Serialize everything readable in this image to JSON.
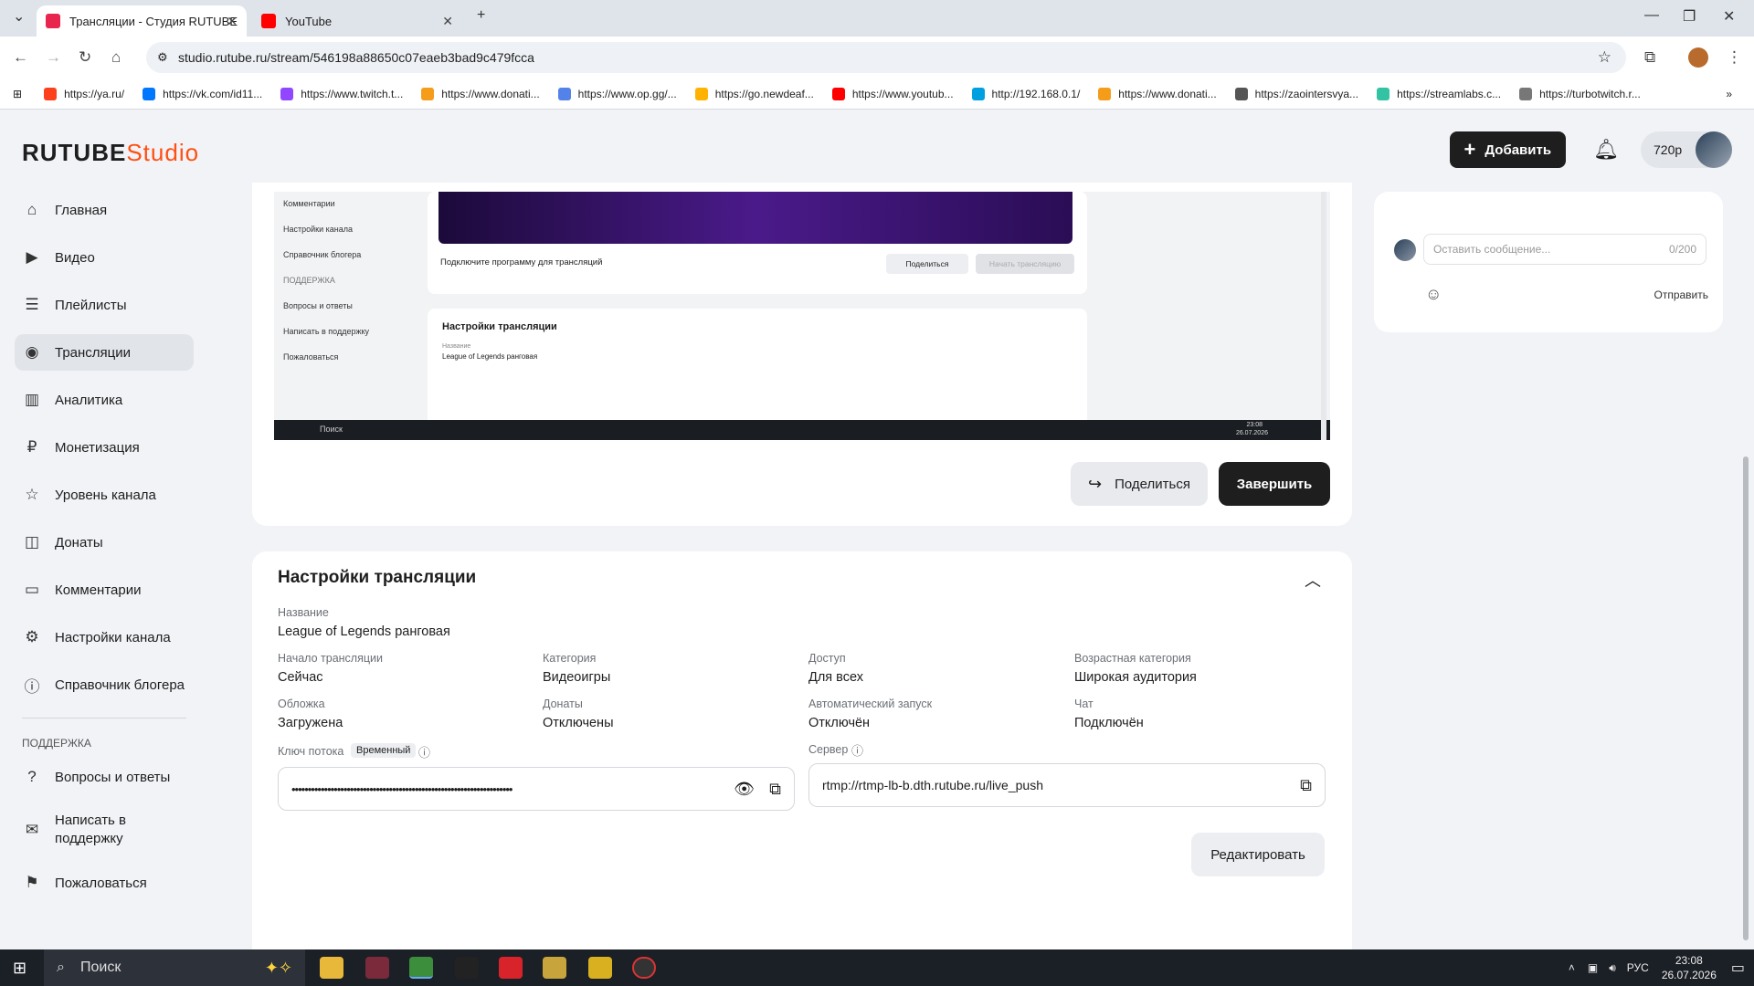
{
  "browser": {
    "tabs": [
      {
        "label": "Трансляции - Студия RUTUBE",
        "active": true,
        "favicon_color": "#e8254f"
      },
      {
        "label": "YouTube",
        "active": false,
        "favicon_color": "#ff0000"
      }
    ],
    "url": "studio.rutube.ru/stream/546198a88650c07eaeb3bad9c479fcca",
    "bookmarks": [
      {
        "label": "https://ya.ru/",
        "color": "#fc3f1d"
      },
      {
        "label": "https://vk.com/id11...",
        "color": "#0077ff"
      },
      {
        "label": "https://www.twitch.t...",
        "color": "#9146ff"
      },
      {
        "label": "https://www.donati...",
        "color": "#f59c1a"
      },
      {
        "label": "https://www.op.gg/...",
        "color": "#5383e8"
      },
      {
        "label": "https://go.newdeaf...",
        "color": "#ffb300"
      },
      {
        "label": "https://www.youtub...",
        "color": "#ff0000"
      },
      {
        "label": "http://192.168.0.1/",
        "color": "#00a0e0"
      },
      {
        "label": "https://www.donati...",
        "color": "#f59c1a"
      },
      {
        "label": "https://zaointersvya...",
        "color": "#555555"
      },
      {
        "label": "https://streamlabs.c...",
        "color": "#31c3a2"
      },
      {
        "label": "https://turbotwitch.r...",
        "color": "#777777"
      }
    ]
  },
  "header": {
    "logo_main": "RUTUBE",
    "logo_studio": "Studio",
    "add_label": "Добавить",
    "quality": "720p"
  },
  "sidebar": {
    "items": [
      {
        "label": "Главная",
        "icon": "home-icon",
        "glyph": "⌂",
        "active": false
      },
      {
        "label": "Видео",
        "icon": "video-icon",
        "glyph": "▶",
        "active": false
      },
      {
        "label": "Плейлисты",
        "icon": "playlist-icon",
        "glyph": "☰",
        "active": false
      },
      {
        "label": "Трансляции",
        "icon": "broadcast-icon",
        "glyph": "◉",
        "active": true
      },
      {
        "label": "Аналитика",
        "icon": "analytics-icon",
        "glyph": "▥",
        "active": false
      },
      {
        "label": "Монетизация",
        "icon": "money-icon",
        "glyph": "₽",
        "active": false
      },
      {
        "label": "Уровень канала",
        "icon": "star-icon",
        "glyph": "☆",
        "active": false
      },
      {
        "label": "Донаты",
        "icon": "donate-icon",
        "glyph": "◫",
        "active": false
      },
      {
        "label": "Комментарии",
        "icon": "comment-icon",
        "glyph": "▭",
        "active": false
      },
      {
        "label": "Настройки канала",
        "icon": "gear-icon",
        "glyph": "⚙",
        "active": false
      },
      {
        "label": "Справочник блогера",
        "icon": "info-icon",
        "glyph": "ⓘ",
        "active": false
      }
    ],
    "support_title": "ПОДДЕРЖКА",
    "support_items": [
      {
        "label": "Вопросы и ответы",
        "icon": "help-icon",
        "glyph": "?"
      },
      {
        "label": "Написать в поддержку",
        "icon": "mail-icon",
        "glyph": "✉"
      },
      {
        "label": "Пожаловаться",
        "icon": "flag-icon",
        "glyph": "⚑"
      }
    ]
  },
  "preview": {
    "sidebar_items": [
      "Комментарии",
      "Настройки канала",
      "Справочник блогера",
      "ПОДДЕРЖКА",
      "Вопросы и ответы",
      "Написать в поддержку",
      "Пожаловаться"
    ],
    "connect_hint": "Подключите программу для трансляций",
    "share": "Поделиться",
    "start": "Начать трансляцию",
    "settings_title": "Настройки трансляции",
    "name_label": "Название",
    "name_value": "League of Legends ранговая",
    "search": "Поиск",
    "time": "23:08",
    "date": "26.07.2026"
  },
  "actions": {
    "share_label": "Поделиться",
    "finish_label": "Завершить"
  },
  "settings": {
    "title": "Настройки трансляции",
    "name_label": "Название",
    "name_value": "League of Legends ранговая",
    "fields": [
      {
        "label": "Начало трансляции",
        "value": "Сейчас"
      },
      {
        "label": "Категория",
        "value": "Видеоигры"
      },
      {
        "label": "Доступ",
        "value": "Для всех"
      },
      {
        "label": "Возрастная категория",
        "value": "Широкая аудитория"
      },
      {
        "label": "Обложка",
        "value": "Загружена"
      },
      {
        "label": "Донаты",
        "value": "Отключены"
      },
      {
        "label": "Автоматический запуск",
        "value": "Отключён"
      },
      {
        "label": "Чат",
        "value": "Подключён"
      }
    ],
    "key_label": "Ключ потока",
    "key_badge": "Временный",
    "key_value": "••••••••••••••••••••••••••••••••••••••••••••••••••••••••••••••••••••",
    "server_label": "Сервер",
    "server_value": "rtmp://rtmp-lb-b.dth.rutube.ru/live_push",
    "edit_label": "Редактировать"
  },
  "chat": {
    "placeholder": "Оставить сообщение...",
    "counter": "0/200",
    "send_label": "Отправить"
  },
  "taskbar": {
    "search": "Поиск",
    "lang": "РУС",
    "time": "23:08",
    "date": "26.07.2026"
  }
}
